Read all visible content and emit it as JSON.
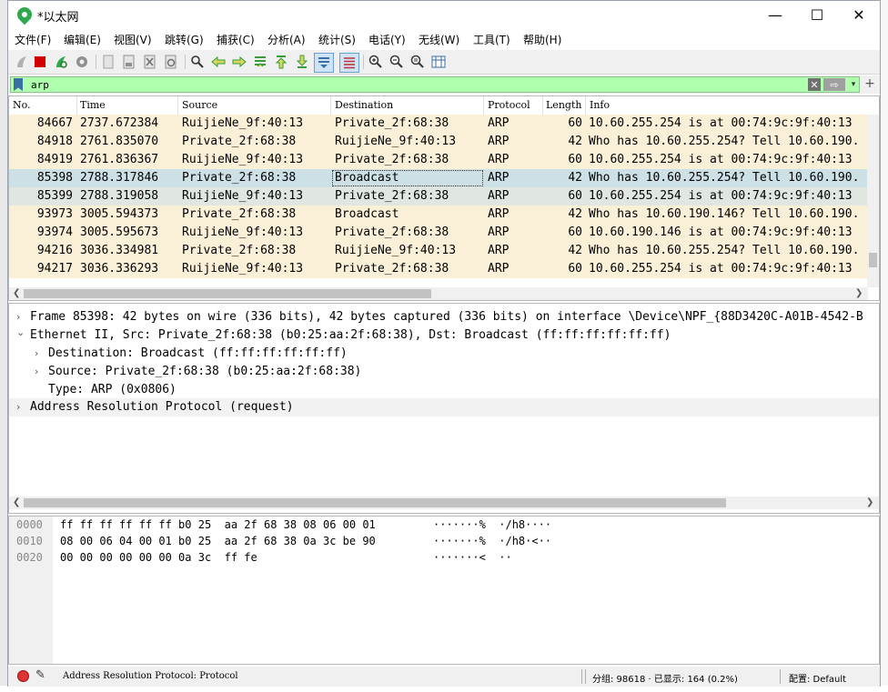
{
  "window": {
    "title": "*以太网",
    "minimize_glyph": "—",
    "maximize_glyph": "☐",
    "close_glyph": "✕"
  },
  "menu": {
    "items": [
      {
        "label": "文件(F)"
      },
      {
        "label": "编辑(E)"
      },
      {
        "label": "视图(V)"
      },
      {
        "label": "跳转(G)"
      },
      {
        "label": "捕获(C)"
      },
      {
        "label": "分析(A)"
      },
      {
        "label": "统计(S)"
      },
      {
        "label": "电话(Y)"
      },
      {
        "label": "无线(W)"
      },
      {
        "label": "工具(T)"
      },
      {
        "label": "帮助(H)"
      }
    ]
  },
  "toolbar": {
    "icons": [
      "shark-fin-start-icon",
      "stop-capture-icon",
      "restart-capture-icon",
      "capture-options-icon",
      "open-file-icon",
      "save-file-icon",
      "close-file-icon",
      "reload-file-icon",
      "find-packet-icon",
      "go-back-icon",
      "go-forward-icon",
      "go-to-packet-icon",
      "first-packet-icon",
      "last-packet-icon",
      "auto-scroll-icon",
      "colorize-icon",
      "zoom-in-icon",
      "zoom-out-icon",
      "normal-size-icon",
      "resize-columns-icon"
    ],
    "colors": {
      "stop": "#d40000",
      "start": "#2fa84f",
      "arrow": "#3b9a3b"
    }
  },
  "filter": {
    "value": "arp",
    "bg_color": "#afffaf",
    "clear_glyph": "✕",
    "apply_glyph": "⇨",
    "dropdown_glyph": "▾",
    "add_glyph": "+"
  },
  "packet_list": {
    "columns": [
      "No.",
      "Time",
      "Source",
      "Destination",
      "Protocol",
      "Length",
      "Info"
    ],
    "sort_indicator": "^",
    "rows": [
      {
        "no": "84667",
        "time": "2737.672384",
        "source": "RuijieNe_9f:40:13",
        "destination": "Private_2f:68:38",
        "protocol": "ARP",
        "length": "60",
        "info": "10.60.255.254 is at 00:74:9c:9f:40:13"
      },
      {
        "no": "84918",
        "time": "2761.835070",
        "source": "Private_2f:68:38",
        "destination": "RuijieNe_9f:40:13",
        "protocol": "ARP",
        "length": "42",
        "info": "Who has 10.60.255.254? Tell 10.60.190."
      },
      {
        "no": "84919",
        "time": "2761.836367",
        "source": "RuijieNe_9f:40:13",
        "destination": "Private_2f:68:38",
        "protocol": "ARP",
        "length": "60",
        "info": "10.60.255.254 is at 00:74:9c:9f:40:13"
      },
      {
        "no": "85398",
        "time": "2788.317846",
        "source": "Private_2f:68:38",
        "destination": "Broadcast",
        "protocol": "ARP",
        "length": "42",
        "info": "Who has 10.60.255.254? Tell 10.60.190."
      },
      {
        "no": "85399",
        "time": "2788.319058",
        "source": "RuijieNe_9f:40:13",
        "destination": "Private_2f:68:38",
        "protocol": "ARP",
        "length": "60",
        "info": "10.60.255.254 is at 00:74:9c:9f:40:13"
      },
      {
        "no": "93973",
        "time": "3005.594373",
        "source": "Private_2f:68:38",
        "destination": "Broadcast",
        "protocol": "ARP",
        "length": "42",
        "info": "Who has 10.60.190.146? Tell 10.60.190."
      },
      {
        "no": "93974",
        "time": "3005.595673",
        "source": "RuijieNe_9f:40:13",
        "destination": "Private_2f:68:38",
        "protocol": "ARP",
        "length": "60",
        "info": "10.60.190.146 is at 00:74:9c:9f:40:13"
      },
      {
        "no": "94216",
        "time": "3036.334981",
        "source": "Private_2f:68:38",
        "destination": "RuijieNe_9f:40:13",
        "protocol": "ARP",
        "length": "42",
        "info": "Who has 10.60.255.254? Tell 10.60.190."
      },
      {
        "no": "94217",
        "time": "3036.336293",
        "source": "RuijieNe_9f:40:13",
        "destination": "Private_2f:68:38",
        "protocol": "ARP",
        "length": "60",
        "info": "10.60.255.254 is at 00:74:9c:9f:40:13"
      }
    ],
    "selected_index": 3,
    "colors": {
      "row": "#faf0d7",
      "selected": "#cce0e6",
      "related": "#dfe7e0"
    }
  },
  "details": {
    "rows": [
      {
        "caret": "›",
        "text": "Frame 85398: 42 bytes on wire (336 bits), 42 bytes captured (336 bits) on interface \\Device\\NPF_{88D3420C-A01B-4542-B"
      },
      {
        "caret": "⌄",
        "text": "Ethernet II, Src: Private_2f:68:38 (b0:25:aa:2f:68:38), Dst: Broadcast (ff:ff:ff:ff:ff:ff)"
      },
      {
        "caret": "›",
        "text": "Destination: Broadcast (ff:ff:ff:ff:ff:ff)"
      },
      {
        "caret": "›",
        "text": "Source: Private_2f:68:38 (b0:25:aa:2f:68:38)"
      },
      {
        "caret": "",
        "text": "Type: ARP (0x0806)"
      },
      {
        "caret": "›",
        "text": "Address Resolution Protocol (request)"
      }
    ]
  },
  "bytes": {
    "lines": [
      {
        "offset": "0000",
        "hex": "ff ff ff ff ff ff b0 25  aa 2f 68 38 08 06 00 01",
        "ascii": "·······%  ·/h8····"
      },
      {
        "offset": "0010",
        "hex": "08 00 06 04 00 01 b0 25  aa 2f 68 38 0a 3c be 90",
        "ascii": "·······%  ·/h8·<··"
      },
      {
        "offset": "0020",
        "hex": "00 00 00 00 00 00 0a 3c  ff fe",
        "ascii": "·······<  ··"
      }
    ]
  },
  "status": {
    "field_info": "Address Resolution Protocol: Protocol",
    "packets": "分组: 98618 · 已显示: 164 (0.2%)",
    "profile": "配置: Default"
  }
}
